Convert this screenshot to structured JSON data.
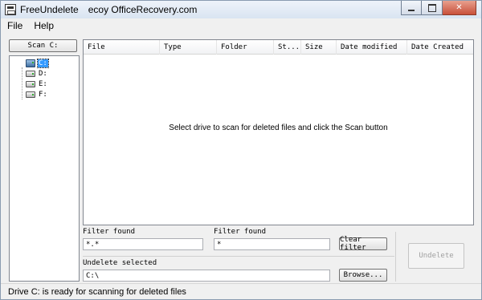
{
  "window": {
    "title_app": "FreeUndelete",
    "title_vendor": "ecoy OfficeRecovery.com",
    "close_glyph": "✕"
  },
  "menu": [
    "File",
    "Help"
  ],
  "scan_button": "Scan C:",
  "drives": [
    {
      "label": "C:",
      "selected": true
    },
    {
      "label": "D:",
      "selected": false
    },
    {
      "label": "E:",
      "selected": false
    },
    {
      "label": "F:",
      "selected": false
    }
  ],
  "file_list": {
    "columns": [
      "File",
      "Type",
      "Folder",
      "St...",
      "Size",
      "Date modified",
      "Date Created"
    ],
    "empty_message": "Select drive to scan for deleted files and click the Scan button"
  },
  "filters": {
    "label_1": "Filter found",
    "value_1": "*.*",
    "label_2": "Filter found",
    "value_2": "*",
    "clear_button": "Clear filter"
  },
  "undelete": {
    "label": "Undelete selected",
    "path": "C:\\",
    "browse_button": "Browse...",
    "undelete_button": "Undelete"
  },
  "status": "Drive C: is ready for scanning for deleted files"
}
